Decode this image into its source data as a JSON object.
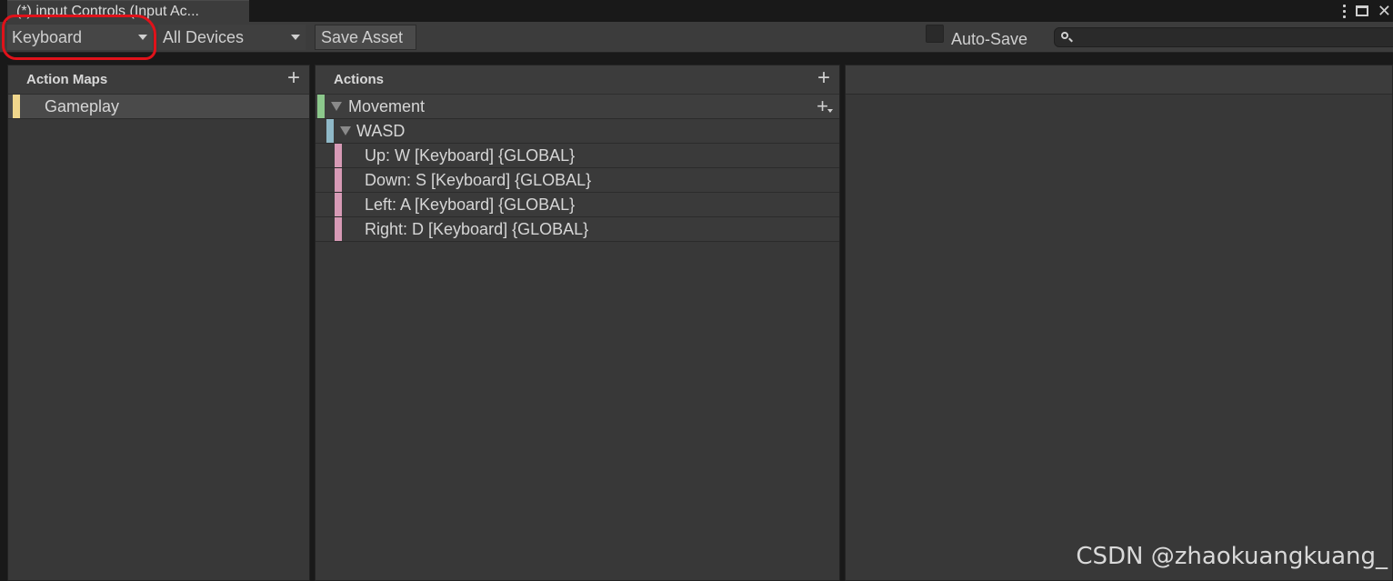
{
  "window": {
    "tab_title": "(*) input Controls (Input Ac...",
    "controls": [
      "kebab-menu-icon",
      "maximize-icon",
      "close-icon"
    ],
    "close_glyph": "✕"
  },
  "toolbar": {
    "control_scheme": "Keyboard",
    "devices": "All Devices",
    "save_label": "Save Asset",
    "autosave_label": "Auto-Save",
    "autosave_checked": false,
    "search_value": "",
    "search_icon": "search-icon"
  },
  "action_maps": {
    "header": "Action Maps",
    "add_glyph": "+",
    "items": [
      {
        "label": "Gameplay",
        "color": "#f0d68c",
        "selected": true
      }
    ]
  },
  "actions": {
    "header": "Actions",
    "add_glyph": "+",
    "action": {
      "label": "Movement",
      "color": "#8cc88c",
      "expanded": true
    },
    "composite": {
      "label": "WASD",
      "color": "#8fb9c8",
      "expanded": true
    },
    "bindings": [
      {
        "label": "Up: W [Keyboard] {GLOBAL}",
        "color": "#d79ab6"
      },
      {
        "label": "Down: S [Keyboard] {GLOBAL}",
        "color": "#d79ab6"
      },
      {
        "label": "Left: A [Keyboard] {GLOBAL}",
        "color": "#d79ab6"
      },
      {
        "label": "Right: D [Keyboard] {GLOBAL}",
        "color": "#d79ab6"
      }
    ]
  },
  "annotation": {
    "color": "#e0121a",
    "target": "control-scheme-dropdown"
  },
  "watermark": "CSDN @zhaokuangkuang_"
}
